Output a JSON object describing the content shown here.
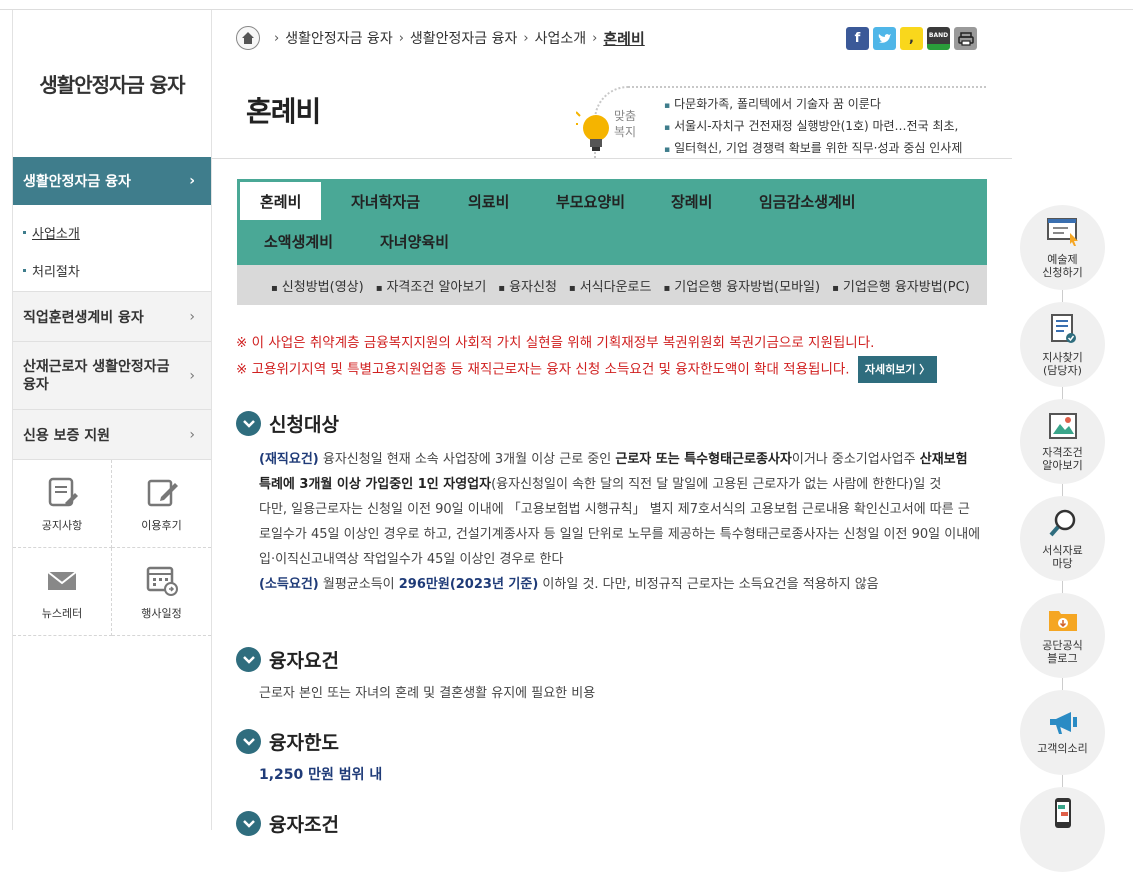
{
  "sidebar": {
    "title": "생활안정자금 융자",
    "active": "생활안정자금 융자",
    "sub_items": [
      "사업소개",
      "처리절차"
    ],
    "items": [
      {
        "label": "직업훈련생계비 융자"
      },
      {
        "label": "산재근로자 생활안정자금 융자"
      },
      {
        "label": "신용 보증 지원"
      }
    ],
    "quick": [
      {
        "label": "공지사항",
        "icon": "notice-icon"
      },
      {
        "label": "이용후기",
        "icon": "review-icon"
      },
      {
        "label": "뉴스레터",
        "icon": "newsletter-icon"
      },
      {
        "label": "행사일정",
        "icon": "calendar-icon"
      }
    ]
  },
  "breadcrumb": [
    "생활안정자금 융자",
    "생활안정자금 융자",
    "사업소개",
    "혼례비"
  ],
  "share": [
    {
      "icon": "facebook-icon",
      "color": "#3b5998"
    },
    {
      "icon": "twitter-icon",
      "color": "#4fb6e8"
    },
    {
      "icon": "kakaostory-icon",
      "color": "#f9d71c"
    },
    {
      "icon": "band-icon",
      "color": "#2a9d3a"
    },
    {
      "icon": "print-icon",
      "color": "#888888"
    }
  ],
  "page_title": "혼례비",
  "welfare": {
    "label1": "맞춤",
    "label2": "복지",
    "items": [
      "다문화가족, 폴리텍에서 기술자 꿈 이룬다",
      "서울시-자치구 건전재정 실행방안(1호) 마련…전국 최초,",
      "일터혁신, 기업 경쟁력 확보를 위한 직무·성과 중심 인사제"
    ]
  },
  "tabs": [
    "혼례비",
    "자녀학자금",
    "의료비",
    "부모요양비",
    "장례비",
    "임금감소생계비",
    "소액생계비",
    "자녀양육비"
  ],
  "subtabs": [
    "신청방법(영상)",
    "자격조건 알아보기",
    "융자신청",
    "서식다운로드",
    "기업은행 융자방법(모바일)",
    "기업은행 융자방법(PC)"
  ],
  "notice": {
    "line1": "※ 이 사업은 취약계층 금융복지지원의 사회적 가치 실현을 위해 기획재정부 복권위원회 복권기금으로 지원됩니다.",
    "line2": "※ 고용위기지역 및 특별고용지원업종 등 재직근로자는 융자 신청 소득요건 및 융자한도액이 확대 적용됩니다.",
    "detail_button": "자세히보기 〉"
  },
  "sections": {
    "target": {
      "title": "신청대상",
      "tag1": "(재직요건)",
      "p1a": " 융자신청일 현재 소속 사업장에 3개월 이상 근로 중인 ",
      "p1b": "근로자 또는 특수형태근로종사자",
      "p1c": "이거나 중소기업사업주 ",
      "p1d": "산재보험 특례에 3개월 이상 가입중인 1인 자영업자",
      "p1e": "(융자신청일이 속한 달의 직전 달 말일에 고용된 근로자가 없는 사람에 한한다)일 것",
      "p2": "다만, 일용근로자는 신청일 이전 90일 이내에 「고용보험법 시행규칙」 별지 제7호서식의 고용보험 근로내용 확인신고서에 따른 근로일수가 45일 이상인 경우로 하고, 건설기계종사자 등 일일 단위로 노무를 제공하는 특수형태근로종사자는 신청일 이전 90일 이내에 입·이직신고내역상 작업일수가 45일 이상인 경우로 한다",
      "tag2": "(소득요건)",
      "p3a": " 월평균소득이 ",
      "p3b": "296만원(2023년 기준)",
      "p3c": " 이하일 것. 다만, 비정규직 근로자는 소득요건을 적용하지 않음"
    },
    "requirement": {
      "title": "융자요건",
      "body": "근로자 본인 또는 자녀의 혼례 및 결혼생활 유지에 필요한 비용"
    },
    "limit": {
      "title": "융자한도",
      "body": "1,250 만원 범위 내"
    },
    "condition": {
      "title": "융자조건"
    }
  },
  "right_quick": [
    {
      "label1": "예술제",
      "label2": "신청하기",
      "icon": "art-apply-icon"
    },
    {
      "label1": "지사찾기",
      "label2": "(담당자)",
      "icon": "branch-find-icon"
    },
    {
      "label1": "자격조건",
      "label2": "알아보기",
      "icon": "eligibility-icon"
    },
    {
      "label1": "서식자료",
      "label2": "마당",
      "icon": "form-search-icon"
    },
    {
      "label1": "공단공식",
      "label2": "블로그",
      "icon": "blog-icon"
    },
    {
      "label1": "고객의소리",
      "label2": "",
      "icon": "megaphone-icon"
    },
    {
      "label1": "",
      "label2": "",
      "icon": "mobile-icon"
    }
  ]
}
